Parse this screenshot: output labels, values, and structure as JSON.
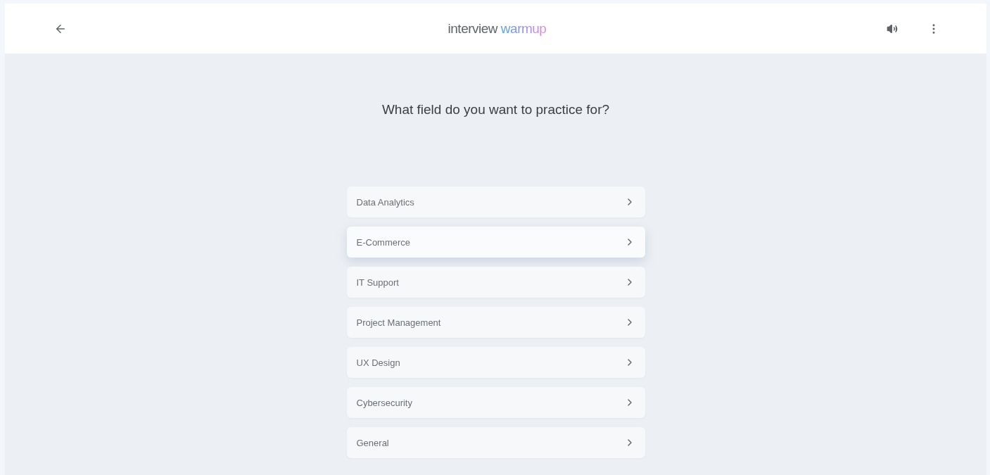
{
  "header": {
    "logo": {
      "first": "interview",
      "second": "warmup"
    }
  },
  "question": "What field do you want to practice for?",
  "fields": [
    {
      "label": "Data Analytics",
      "highlighted": false
    },
    {
      "label": "E-Commerce",
      "highlighted": true
    },
    {
      "label": "IT Support",
      "highlighted": false
    },
    {
      "label": "Project Management",
      "highlighted": false
    },
    {
      "label": "UX Design",
      "highlighted": false
    },
    {
      "label": "Cybersecurity",
      "highlighted": false
    },
    {
      "label": "General",
      "highlighted": false
    }
  ]
}
